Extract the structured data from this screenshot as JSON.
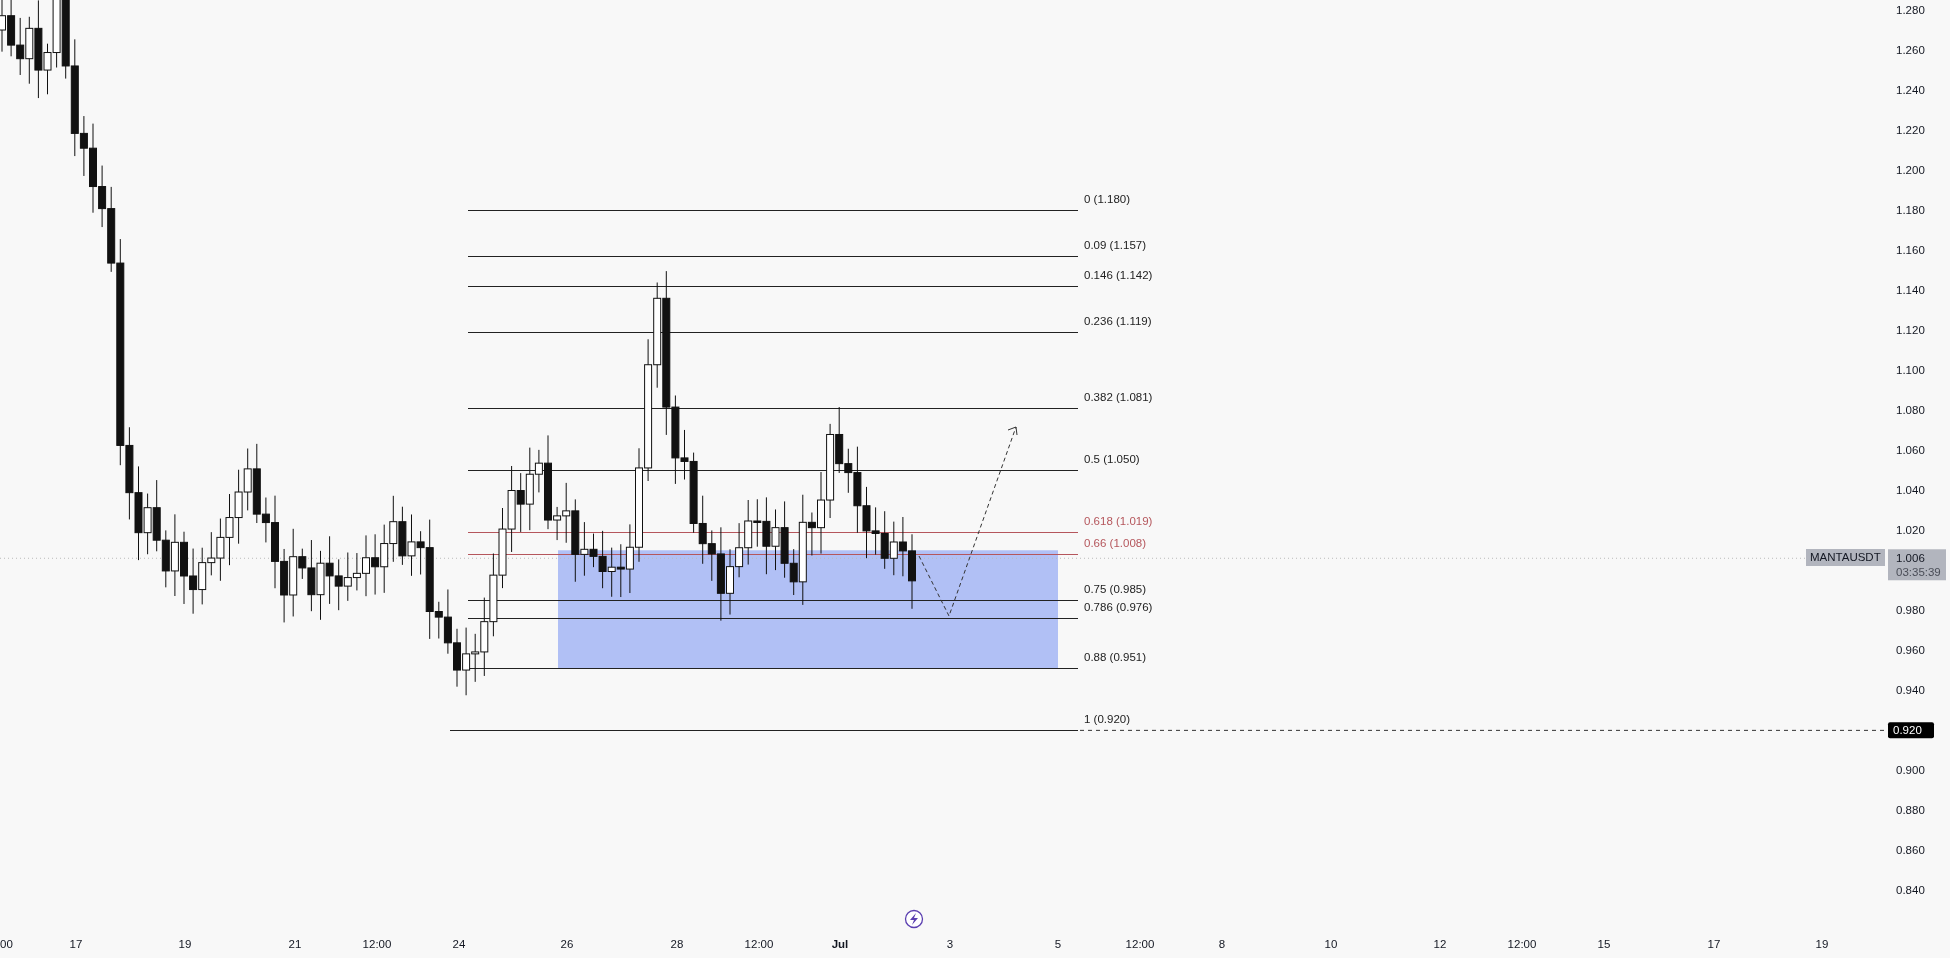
{
  "chart": {
    "symbol_label": "MANTAUSDT",
    "last_price": "1.006",
    "countdown": "03:35:39",
    "low_marker": "0.920",
    "price_axis": [
      "1.280",
      "1.260",
      "1.240",
      "1.220",
      "1.200",
      "1.180",
      "1.160",
      "1.140",
      "1.120",
      "1.100",
      "1.080",
      "1.060",
      "1.040",
      "1.020",
      "0.980",
      "0.960",
      "0.940",
      "0.900",
      "0.880",
      "0.860",
      "0.840"
    ],
    "time_axis": [
      {
        "label": "00",
        "bold": false
      },
      {
        "label": "17",
        "bold": false
      },
      {
        "label": "19",
        "bold": false
      },
      {
        "label": "21",
        "bold": false
      },
      {
        "label": "12:00",
        "bold": false
      },
      {
        "label": "24",
        "bold": false
      },
      {
        "label": "26",
        "bold": false
      },
      {
        "label": "28",
        "bold": false
      },
      {
        "label": "12:00",
        "bold": false
      },
      {
        "label": "Jul",
        "bold": true
      },
      {
        "label": "3",
        "bold": false
      },
      {
        "label": "5",
        "bold": false
      },
      {
        "label": "12:00",
        "bold": false
      },
      {
        "label": "8",
        "bold": false
      },
      {
        "label": "10",
        "bold": false
      },
      {
        "label": "12",
        "bold": false
      },
      {
        "label": "12:00",
        "bold": false
      },
      {
        "label": "15",
        "bold": false
      },
      {
        "label": "17",
        "bold": false
      },
      {
        "label": "19",
        "bold": false
      }
    ],
    "fib_levels": [
      {
        "label": "0 (1.180)",
        "color": "#222222"
      },
      {
        "label": "0.09 (1.157)",
        "color": "#222222"
      },
      {
        "label": "0.146 (1.142)",
        "color": "#222222"
      },
      {
        "label": "0.236 (1.119)",
        "color": "#222222"
      },
      {
        "label": "0.382 (1.081)",
        "color": "#222222"
      },
      {
        "label": "0.5 (1.050)",
        "color": "#222222"
      },
      {
        "label": "0.618 (1.019)",
        "color": "#b5565c"
      },
      {
        "label": "0.66 (1.008)",
        "color": "#b5565c"
      },
      {
        "label": "0.75 (0.985)",
        "color": "#222222"
      },
      {
        "label": "0.786 (0.976)",
        "color": "#222222"
      },
      {
        "label": "0.88 (0.951)",
        "color": "#222222"
      },
      {
        "label": "1 (0.920)",
        "color": "#222222"
      }
    ]
  }
}
